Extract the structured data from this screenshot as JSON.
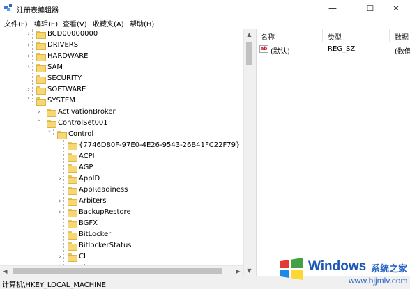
{
  "window": {
    "title": "注册表编辑器",
    "controls": {
      "minimize": "—",
      "maximize": "☐",
      "close": "✕"
    }
  },
  "menu": {
    "items": [
      {
        "label": "文件(F)"
      },
      {
        "label": "编辑(E)"
      },
      {
        "label": "查看(V)"
      },
      {
        "label": "收藏夹(A)"
      },
      {
        "label": "帮助(H)"
      }
    ]
  },
  "tree": {
    "expand_glyph": "›",
    "expanded_glyph": "˅",
    "nodes": [
      {
        "label": "BCD00000000",
        "arrow": "›"
      },
      {
        "label": "DRIVERS",
        "arrow": "›"
      },
      {
        "label": "HARDWARE",
        "arrow": "›"
      },
      {
        "label": "SAM",
        "arrow": "›"
      },
      {
        "label": "SECURITY",
        "arrow": ""
      },
      {
        "label": "SOFTWARE",
        "arrow": "›"
      },
      {
        "label": "SYSTEM",
        "arrow": "˅"
      },
      {
        "label": "ActivationBroker",
        "arrow": "›"
      },
      {
        "label": "ControlSet001",
        "arrow": "˅"
      },
      {
        "label": "Control",
        "arrow": "˅"
      },
      {
        "label": "{7746D80F-97E0-4E26-9543-26B41FC22F79}",
        "arrow": ""
      },
      {
        "label": "ACPI",
        "arrow": ""
      },
      {
        "label": "AGP",
        "arrow": ""
      },
      {
        "label": "AppID",
        "arrow": "›"
      },
      {
        "label": "AppReadiness",
        "arrow": ""
      },
      {
        "label": "Arbiters",
        "arrow": "›"
      },
      {
        "label": "BackupRestore",
        "arrow": "›"
      },
      {
        "label": "BGFX",
        "arrow": ""
      },
      {
        "label": "BitLocker",
        "arrow": ""
      },
      {
        "label": "BitlockerStatus",
        "arrow": ""
      },
      {
        "label": "CI",
        "arrow": "›"
      },
      {
        "label": "Class",
        "arrow": "˅"
      }
    ]
  },
  "scrollbars": {
    "up": "▲",
    "down": "▼",
    "left": "◀",
    "right": "▶"
  },
  "values_pane": {
    "columns": [
      "名称",
      "类型",
      "数据"
    ],
    "rows": [
      {
        "icon": "ab",
        "name": "(默认)",
        "type": "REG_SZ",
        "data": "(数值"
      }
    ]
  },
  "statusbar": {
    "path": "计算机\\HKEY_LOCAL_MACHINE"
  },
  "watermark": {
    "brand": "Windows",
    "brand_cn": "系统之家",
    "url": "www.bjjmlv.com"
  },
  "colors": {
    "folder": "#f7d774",
    "folder_border": "#dcb44a",
    "watermark_blue": "#1c57b8"
  }
}
